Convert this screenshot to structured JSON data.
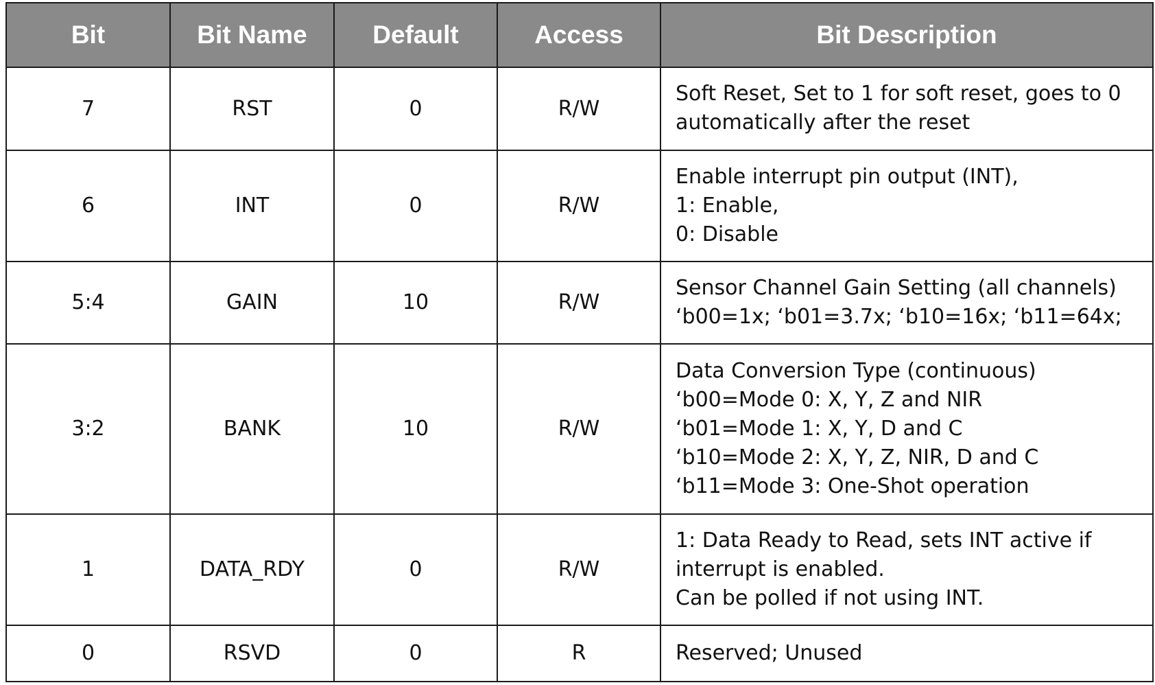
{
  "table": {
    "headers": {
      "bit": "Bit",
      "bit_name": "Bit Name",
      "default": "Default",
      "access": "Access",
      "description": "Bit Description"
    },
    "rows": [
      {
        "bit": "7",
        "name": "RST",
        "default": "0",
        "access": "R/W",
        "description": [
          "Soft Reset, Set to 1 for soft reset, goes to 0",
          "automatically after the reset"
        ]
      },
      {
        "bit": "6",
        "name": "INT",
        "default": "0",
        "access": "R/W",
        "description": [
          "Enable interrupt pin output (INT),",
          "1: Enable,",
          "0: Disable"
        ]
      },
      {
        "bit": "5:4",
        "name": "GAIN",
        "default": "10",
        "access": "R/W",
        "description": [
          "Sensor Channel Gain Setting (all channels)",
          "‘b00=1x; ‘b01=3.7x; ‘b10=16x; ‘b11=64x;"
        ]
      },
      {
        "bit": "3:2",
        "name": "BANK",
        "default": "10",
        "access": "R/W",
        "description": [
          "Data Conversion Type (continuous)",
          "‘b00=Mode 0: X, Y, Z and NIR",
          "‘b01=Mode 1: X, Y, D and C",
          "‘b10=Mode 2: X, Y, Z, NIR, D and C",
          "‘b11=Mode 3: One-Shot operation"
        ]
      },
      {
        "bit": "1",
        "name": "DATA_RDY",
        "default": "0",
        "access": "R/W",
        "description": [
          "1: Data Ready to Read, sets INT active if",
          "interrupt is enabled.",
          "Can be polled if not using INT."
        ]
      },
      {
        "bit": "0",
        "name": "RSVD",
        "default": "0",
        "access": "R",
        "description": [
          "Reserved; Unused"
        ]
      }
    ]
  }
}
